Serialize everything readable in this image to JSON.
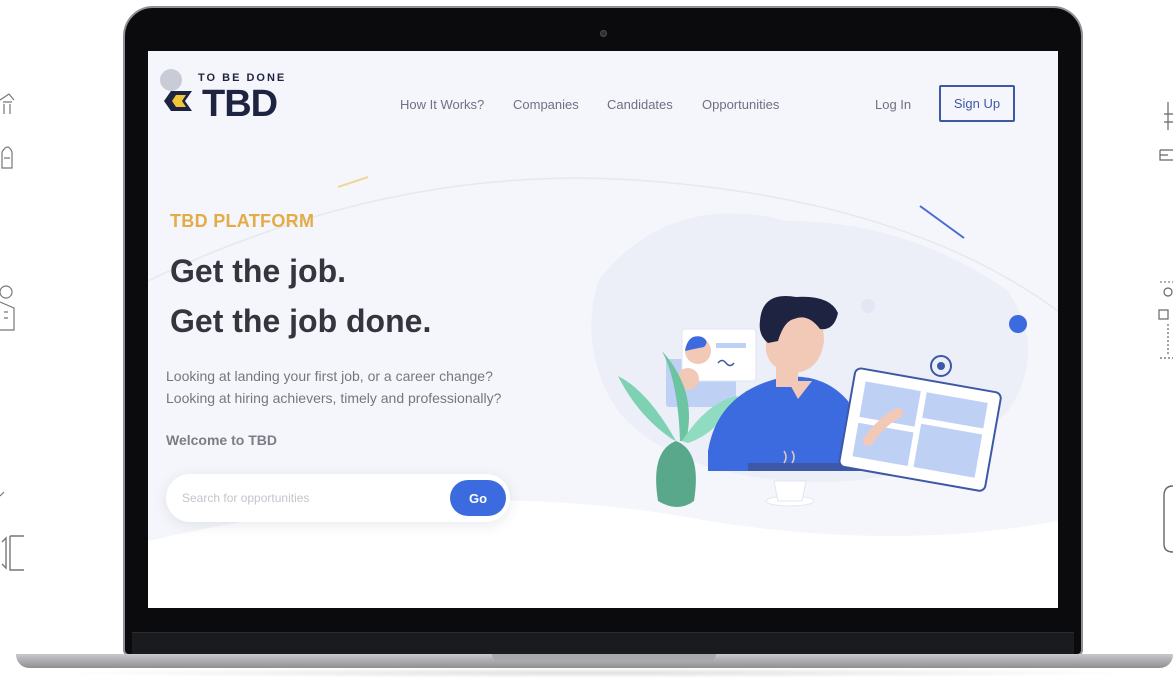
{
  "header": {
    "logo_tagline": "TO BE DONE",
    "logo_text": "TBD",
    "nav": [
      {
        "label": "How It Works?"
      },
      {
        "label": "Companies"
      },
      {
        "label": "Candidates"
      },
      {
        "label": "Opportunities"
      }
    ],
    "login_label": "Log In",
    "signup_label": "Sign Up"
  },
  "hero": {
    "eyebrow": "TBD PLATFORM",
    "headline_1": "Get the job.",
    "headline_2": "Get the job done.",
    "subtext_1": "Looking at landing your first job, or a career change?",
    "subtext_2": "Looking at hiring achievers, timely and professionally?",
    "welcome": "Welcome to TBD",
    "search": {
      "placeholder": "Search for opportunities",
      "button_label": "Go"
    }
  },
  "colors": {
    "brand_navy": "#1e2341",
    "accent_gold": "#e2ac46",
    "primary_blue": "#3c6be0",
    "signup_border": "#3d58a6",
    "page_bg": "#f5f6fb"
  },
  "icons": [
    "logo-mark-icon",
    "hero-illustration",
    "outline-side-icons"
  ]
}
